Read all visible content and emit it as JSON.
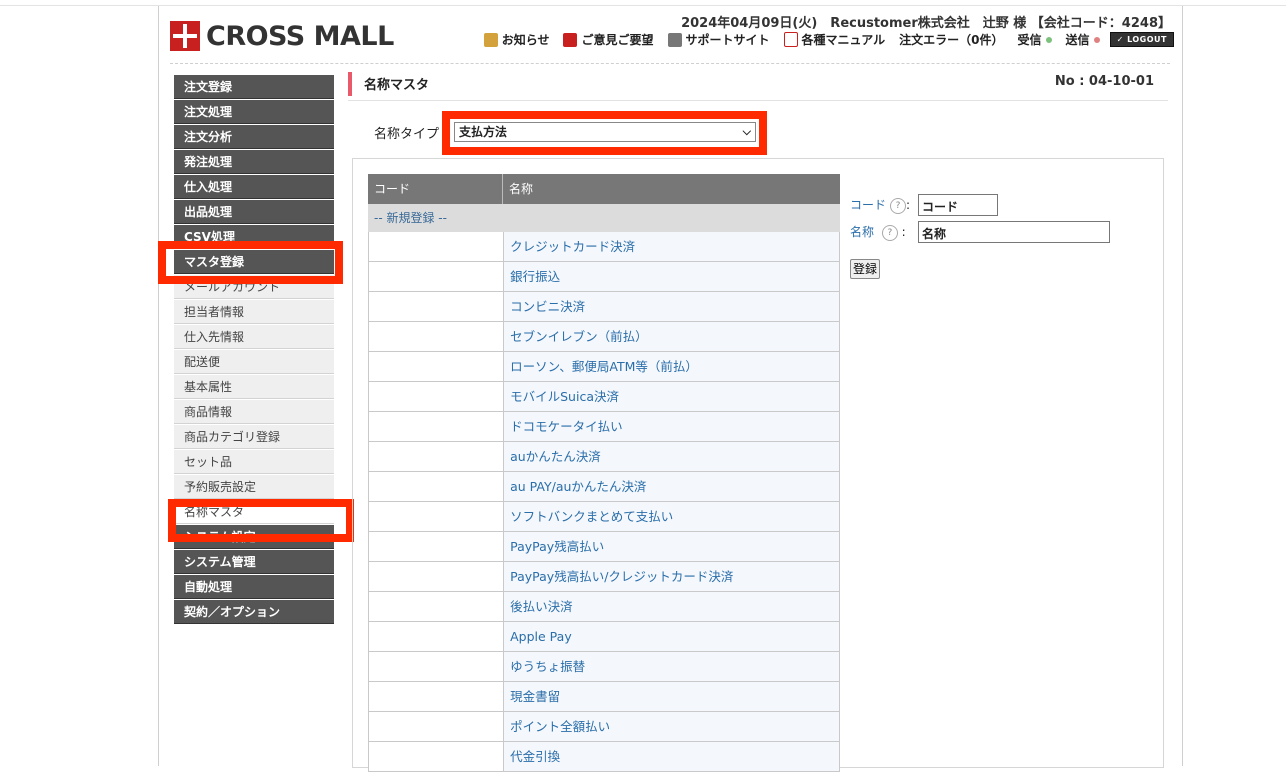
{
  "header": {
    "logo_text": "CROSS MALL",
    "user_line": "2024年04月09日(火)　Recustomer株式会社　辻野 様 【会社コード：4248】",
    "nav": [
      {
        "icon": "bell-icon",
        "label": "お知らせ"
      },
      {
        "icon": "postbox-icon",
        "label": "ご意見ご要望"
      },
      {
        "icon": "help-icon",
        "label": "サポートサイト"
      },
      {
        "icon": "pdf-icon",
        "label": "各種マニュアル"
      }
    ],
    "order_error": "注文エラー（0件）",
    "receive_label": "受信",
    "send_label": "送信",
    "logout_label": "LOGOUT"
  },
  "sidebar": {
    "items": [
      {
        "label": "注文登録",
        "type": "dark"
      },
      {
        "label": "注文処理",
        "type": "dark"
      },
      {
        "label": "注文分析",
        "type": "dark"
      },
      {
        "label": "発注処理",
        "type": "dark"
      },
      {
        "label": "仕入処理",
        "type": "dark"
      },
      {
        "label": "出品処理",
        "type": "dark"
      },
      {
        "label": "CSV処理",
        "type": "dark"
      },
      {
        "label": "マスタ登録",
        "type": "dark"
      },
      {
        "label": "メールアカウント",
        "type": "sub"
      },
      {
        "label": "担当者情報",
        "type": "sub"
      },
      {
        "label": "仕入先情報",
        "type": "sub"
      },
      {
        "label": "配送便",
        "type": "sub"
      },
      {
        "label": "基本属性",
        "type": "sub"
      },
      {
        "label": "商品情報",
        "type": "sub"
      },
      {
        "label": "商品カテゴリ登録",
        "type": "sub"
      },
      {
        "label": "セット品",
        "type": "sub"
      },
      {
        "label": "予約販売設定",
        "type": "sub"
      },
      {
        "label": "名称マスタ",
        "type": "sub active"
      },
      {
        "label": "システム設定",
        "type": "dark"
      },
      {
        "label": "システム管理",
        "type": "dark"
      },
      {
        "label": "自動処理",
        "type": "dark"
      },
      {
        "label": "契約／オプション",
        "type": "dark"
      }
    ]
  },
  "main": {
    "title": "名称マスタ",
    "page_no": "No : 04-10-01",
    "type_label": "名称タイプ",
    "type_value": "支払方法",
    "table": {
      "headers": [
        "コード",
        "名称"
      ],
      "new_row": "-- 新規登録 --",
      "rows": [
        "クレジットカード決済",
        "銀行振込",
        "コンビニ決済",
        "セブンイレブン（前払）",
        "ローソン、郵便局ATM等（前払）",
        "モバイルSuica決済",
        "ドコモケータイ払い",
        "auかんたん決済",
        "au PAY/auかんたん決済",
        "ソフトバンクまとめて支払い",
        "PayPay残高払い",
        "PayPay残高払い/クレジットカード決済",
        "後払い決済",
        "Apple Pay",
        "ゆうちょ振替",
        "現金書留",
        "ポイント全額払い",
        "代金引換"
      ]
    },
    "form": {
      "code_label": "コード",
      "code_value": "コード",
      "name_label": "名称",
      "name_value": "名称",
      "help_mark": "?",
      "colon": ":",
      "register_label": "登録"
    }
  },
  "colors": {
    "highlight": "#ff2a00",
    "sidebar_dark": "#555555",
    "link": "#2a6eaa",
    "title_accent": "#e85a6a"
  }
}
